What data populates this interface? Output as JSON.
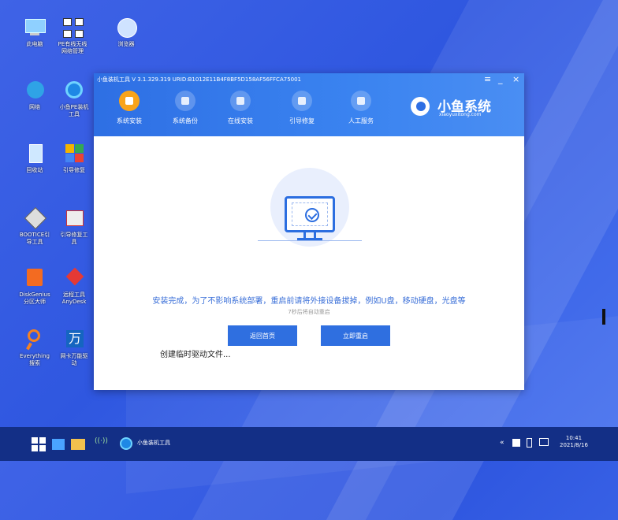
{
  "desktop": {
    "icons": [
      {
        "label": "此电脑"
      },
      {
        "label": "PE有线无线网络管理"
      },
      {
        "label": "浏览器"
      },
      {
        "label": "网络"
      },
      {
        "label": "小鱼PE装机工具"
      },
      {
        "label": "回收站"
      },
      {
        "label": "引导修复"
      },
      {
        "label": "BOOTICE引导工具"
      },
      {
        "label": "引导修复工具"
      },
      {
        "label": "DiskGenius分区大师"
      },
      {
        "label": "远程工具AnyDesk"
      },
      {
        "label": "Everything搜索"
      },
      {
        "label": "网卡万能驱动"
      }
    ]
  },
  "window": {
    "title": "小鱼装机工具 V 3.1.329.319 URID:B1012E11B4F8BF5D158AF56FFCA75001",
    "controls": {
      "menu": "≡",
      "minimize": "_",
      "close": "×"
    },
    "nav": [
      {
        "label": "系统安装",
        "active": true
      },
      {
        "label": "系统备份",
        "active": false
      },
      {
        "label": "在线安装",
        "active": false
      },
      {
        "label": "引导修复",
        "active": false
      },
      {
        "label": "人工服务",
        "active": false
      }
    ],
    "brand": {
      "name": "小鱼系统",
      "url": "xiaoyuxitong.com"
    },
    "message": "安装完成，为了不影响系统部署，重启前请将外接设备拔掉，例如U盘，移动硬盘，光盘等",
    "countdown": "7秒后将自动重启",
    "buttons": {
      "home": "返回首页",
      "restart": "立即重启"
    },
    "copy_status": "创建临时驱动文件..."
  },
  "taskbar": {
    "app_label": "小鱼装机工具",
    "time": "10:41",
    "date": "2021/8/16"
  },
  "colors": {
    "accent": "#2f6fe0",
    "header": "#3a83f0",
    "active_nav": "#f9a41a",
    "taskbar": "#132f86"
  }
}
